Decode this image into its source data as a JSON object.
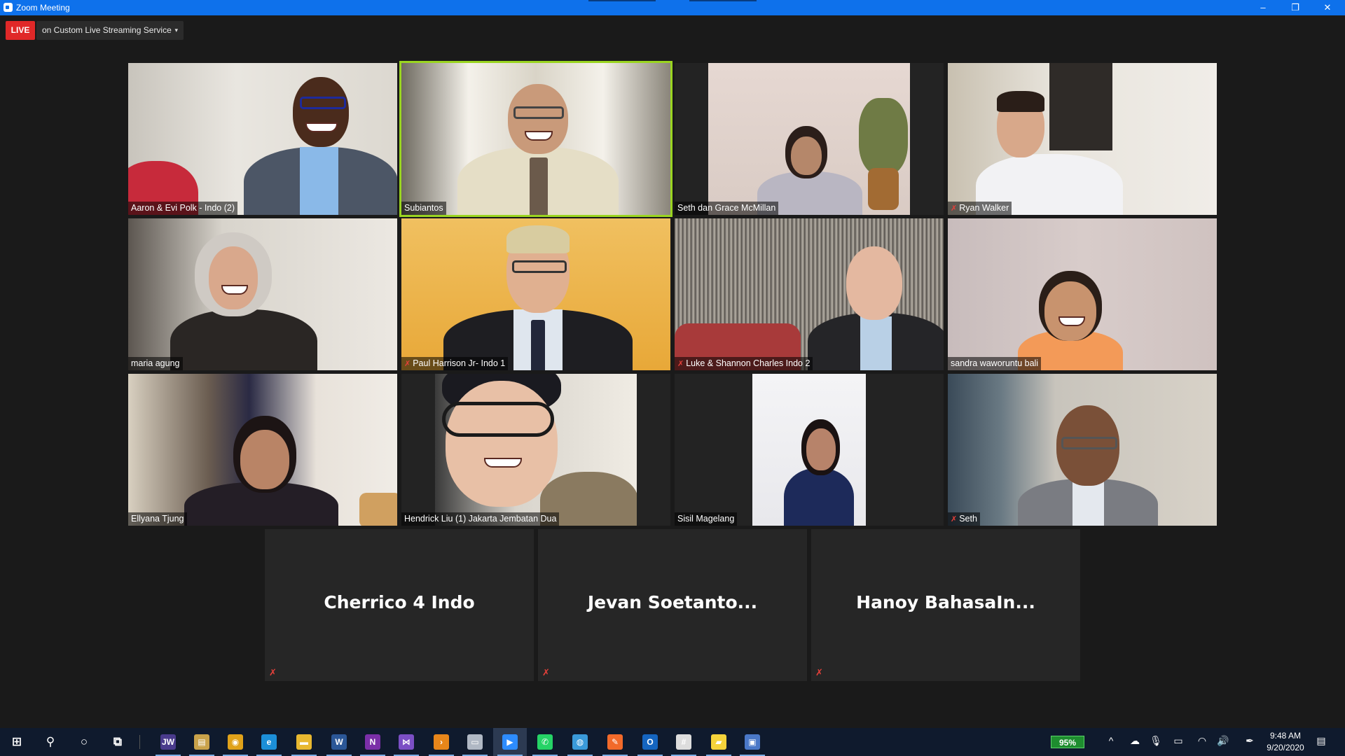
{
  "window": {
    "title": "Zoom Meeting",
    "controls": {
      "minimize": "–",
      "restore": "❐",
      "close": "✕"
    }
  },
  "live": {
    "badge": "LIVE",
    "stream_label": "on Custom Live Streaming Service",
    "caret": "▾"
  },
  "participants": [
    {
      "name": "Aaron & Evi Polk - Indo (2)",
      "muted": false
    },
    {
      "name": "Subiantos",
      "muted": false,
      "speaking": true
    },
    {
      "name": "Seth dan Grace McMillan",
      "muted": false
    },
    {
      "name": "Ryan Walker",
      "muted": true
    },
    {
      "name": "maria agung",
      "muted": false
    },
    {
      "name": "Paul Harrison Jr- Indo 1",
      "muted": true
    },
    {
      "name": "Luke & Shannon Charles Indo 2",
      "muted": true
    },
    {
      "name": "sandra waworuntu bali",
      "muted": false
    },
    {
      "name": "Ellyana Tjung",
      "muted": false
    },
    {
      "name": "Hendrick Liu (1) Jakarta Jembatan Dua",
      "muted": false
    },
    {
      "name": "Sisil Magelang",
      "muted": false
    },
    {
      "name": "Seth",
      "muted": true
    }
  ],
  "audio_only": [
    {
      "name": "Cherrico 4 Indo",
      "muted": true
    },
    {
      "name": "Jevan  Soetanto...",
      "muted": true
    },
    {
      "name": "Hanoy  BahasaIn...",
      "muted": true
    }
  ],
  "mute_glyph": "✗",
  "taskbar": {
    "apps": [
      {
        "name": "start",
        "icon": "windows-icon",
        "glyph": "⊞",
        "color": "#ffffff"
      },
      {
        "name": "search",
        "icon": "search-icon",
        "glyph": "⚲",
        "color": "#ffffff"
      },
      {
        "name": "cortana",
        "icon": "circle-icon",
        "glyph": "○",
        "color": "#ffffff"
      },
      {
        "name": "task-view",
        "icon": "task-view-icon",
        "glyph": "⧉",
        "color": "#ffffff"
      },
      {
        "name": "jw-library",
        "icon": "jw-icon",
        "glyph": "JW",
        "color": "#4a3b8c"
      },
      {
        "name": "store-folder",
        "icon": "store-icon",
        "glyph": "▤",
        "color": "#c9a24a"
      },
      {
        "name": "chrome",
        "icon": "chrome-icon",
        "glyph": "◉",
        "color": "#e0a21a"
      },
      {
        "name": "edge",
        "icon": "edge-icon",
        "glyph": "e",
        "color": "#1c8fd8"
      },
      {
        "name": "file-explorer",
        "icon": "folder-icon",
        "glyph": "▬",
        "color": "#e8b830"
      },
      {
        "name": "word",
        "icon": "word-icon",
        "glyph": "W",
        "color": "#2b5797"
      },
      {
        "name": "onenote",
        "icon": "onenote-icon",
        "glyph": "N",
        "color": "#7b2fa8"
      },
      {
        "name": "visual-studio",
        "icon": "visual-studio-icon",
        "glyph": "⋈",
        "color": "#7b4fc4"
      },
      {
        "name": "terminal",
        "icon": "chevron-right-icon",
        "glyph": "›",
        "color": "#e8861a"
      },
      {
        "name": "snip",
        "icon": "photos-icon",
        "glyph": "▭",
        "color": "#b0b8c4"
      },
      {
        "name": "zoom",
        "icon": "zoom-icon",
        "glyph": "▶",
        "color": "#2d8cff"
      },
      {
        "name": "whatsapp",
        "icon": "whatsapp-icon",
        "glyph": "✆",
        "color": "#25d366"
      },
      {
        "name": "paint",
        "icon": "paint-icon",
        "glyph": "◍",
        "color": "#3a9ad9"
      },
      {
        "name": "pen-app",
        "icon": "pen-icon",
        "glyph": "✎",
        "color": "#f26a2a"
      },
      {
        "name": "outlook",
        "icon": "outlook-icon",
        "glyph": "O",
        "color": "#1565c0"
      },
      {
        "name": "slack",
        "icon": "slack-icon",
        "glyph": "#",
        "color": "#dddddd"
      },
      {
        "name": "sticky-notes",
        "icon": "notes-icon",
        "glyph": "▰",
        "color": "#f5d33b"
      },
      {
        "name": "remote-desktop",
        "icon": "remote-desktop-icon",
        "glyph": "▣",
        "color": "#4a78c8"
      }
    ],
    "battery_label": "95%",
    "tray": [
      {
        "name": "show-hidden",
        "icon": "chevron-up-icon",
        "glyph": "^"
      },
      {
        "name": "onedrive",
        "icon": "cloud-icon",
        "glyph": "☁"
      },
      {
        "name": "microphone",
        "icon": "microphone-icon",
        "glyph": "🎙"
      },
      {
        "name": "battery",
        "icon": "battery-icon",
        "glyph": "▭"
      },
      {
        "name": "wifi",
        "icon": "wifi-icon",
        "glyph": "◠"
      },
      {
        "name": "volume",
        "icon": "volume-icon",
        "glyph": "🔊"
      },
      {
        "name": "pen-workspace",
        "icon": "pen-workspace-icon",
        "glyph": "✒"
      }
    ],
    "time": "9:48 AM",
    "date": "9/20/2020",
    "notification_glyph": "▤"
  }
}
